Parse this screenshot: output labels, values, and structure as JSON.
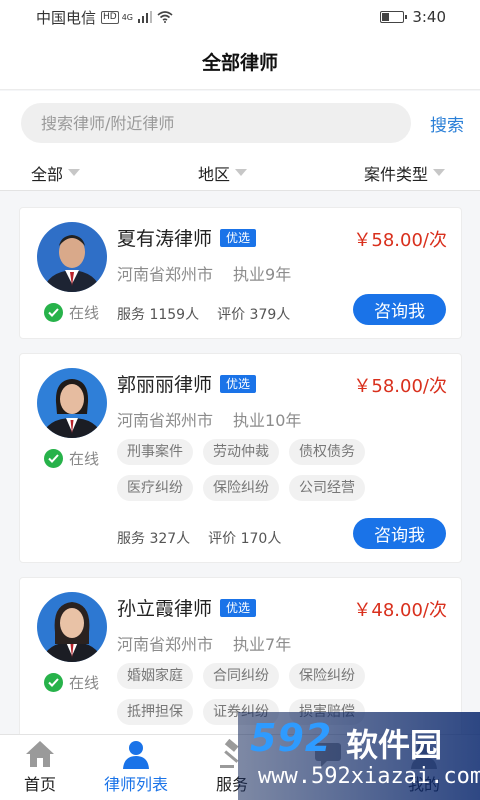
{
  "status_bar": {
    "carrier": "中国电信",
    "hd": "HD",
    "network": "4G",
    "time": "3:40",
    "battery_level": 0.35
  },
  "header": {
    "title": "全部律师"
  },
  "search": {
    "placeholder": "搜索律师/附近律师",
    "button_label": "搜索"
  },
  "filters": [
    {
      "label": "全部"
    },
    {
      "label": "地区"
    },
    {
      "label": "案件类型"
    }
  ],
  "lawyers": [
    {
      "name": "夏有涛律师",
      "badge": "优选",
      "price": "￥58.00/次",
      "location": "河南省郑州市",
      "experience": "执业9年",
      "status": "在线",
      "tags": [],
      "served": "服务 1159人",
      "reviews": "评价 379人",
      "action": "咨询我"
    },
    {
      "name": "郭丽丽律师",
      "badge": "优选",
      "price": "￥58.00/次",
      "location": "河南省郑州市",
      "experience": "执业10年",
      "status": "在线",
      "tags": [
        "刑事案件",
        "劳动仲裁",
        "债权债务",
        "医疗纠纷",
        "保险纠纷",
        "公司经营"
      ],
      "served": "服务 327人",
      "reviews": "评价 170人",
      "action": "咨询我"
    },
    {
      "name": "孙立霞律师",
      "badge": "优选",
      "price": "￥48.00/次",
      "location": "河南省郑州市",
      "experience": "执业7年",
      "status": "在线",
      "tags": [
        "婚姻家庭",
        "合同纠纷",
        "保险纠纷",
        "抵押担保",
        "证券纠纷",
        "损害赔偿"
      ]
    }
  ],
  "tab_bar": {
    "tabs": [
      {
        "label": "首页",
        "icon": "home-icon"
      },
      {
        "label": "律师列表",
        "icon": "person-icon"
      },
      {
        "label": "服务",
        "icon": "gavel-icon"
      },
      {
        "label": "",
        "icon": "message-icon"
      },
      {
        "label": "我的",
        "icon": "profile-icon"
      }
    ],
    "active": 1
  },
  "watermark": {
    "logo": "592",
    "brand": "软件园",
    "url": "www.592xiazai.com"
  },
  "colors": {
    "accent": "#1a73e8",
    "price": "#d9301d",
    "online": "#27b24a"
  }
}
